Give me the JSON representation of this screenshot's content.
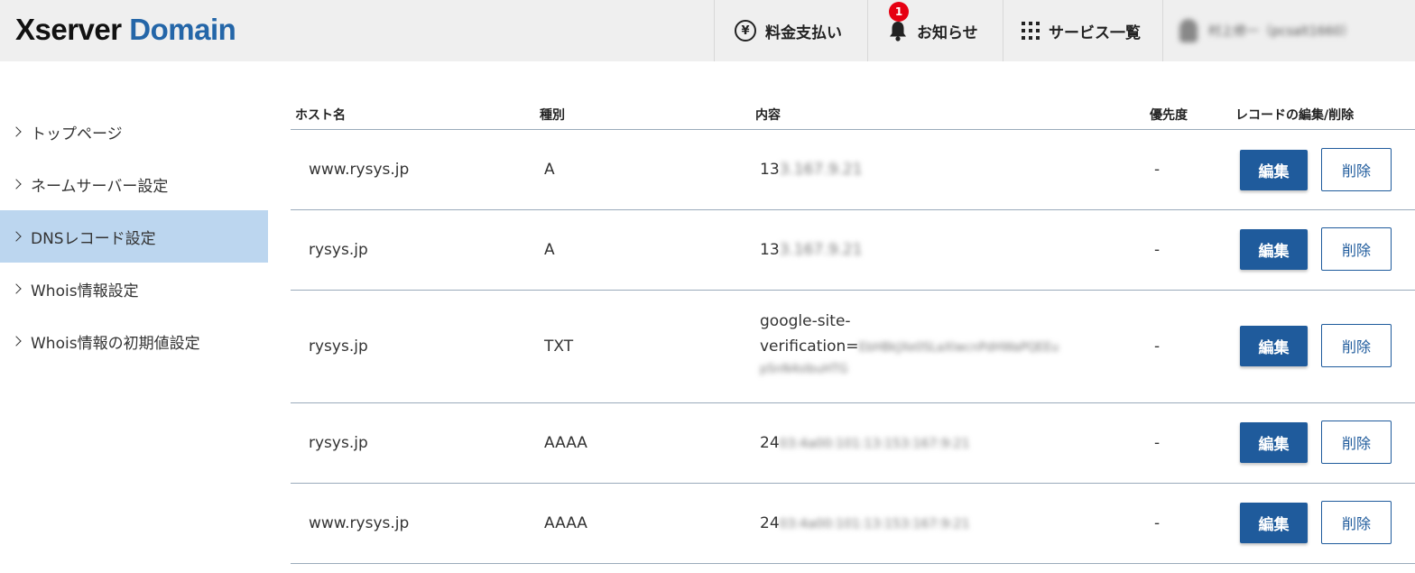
{
  "header": {
    "logo_part1": "Xserver",
    "logo_part2": "Domain",
    "nav": {
      "fee_label": "料金支払い",
      "fee_icon": "yen-circle-icon",
      "news_label": "お知らせ",
      "news_icon": "bell-icon",
      "news_badge": "1",
      "services_label": "サービス一覧",
      "services_icon": "grid-icon",
      "user_label": "村上修一（pcsalt1660）"
    }
  },
  "sidebar": {
    "items": [
      {
        "label": "トップページ"
      },
      {
        "label": "ネームサーバー設定"
      },
      {
        "label": "DNSレコード設定",
        "active": true
      },
      {
        "label": "Whois情報設定"
      },
      {
        "label": "Whois情報の初期値設定"
      }
    ]
  },
  "table": {
    "headers": {
      "host": "ホスト名",
      "type": "種別",
      "content": "内容",
      "priority": "優先度",
      "actions": "レコードの編集/削除"
    },
    "rows": [
      {
        "host": "www.rysys.jp",
        "type": "A",
        "content_visible": "13",
        "content_blurred": "3.167.9.21",
        "priority": "-",
        "edit": "編集",
        "delete": "削除"
      },
      {
        "host": "rysys.jp",
        "type": "A",
        "content_visible": "13",
        "content_blurred": "3.167.9.21",
        "priority": "-",
        "edit": "編集",
        "delete": "削除"
      },
      {
        "host": "rysys.jp",
        "type": "TXT",
        "content_line1": "google-site-",
        "content_line2": "verification=",
        "content_blurred2": "EbHBkJXe0SLaXlwcnPdHWaPQEEu",
        "content_blurred3": "pSnN4sIbuHTG",
        "priority": "-",
        "edit": "編集",
        "delete": "削除"
      },
      {
        "host": "rysys.jp",
        "type": "AAAA",
        "content_visible": "24",
        "content_blurred": "03:4a00:101:13:153:167:9:21",
        "priority": "-",
        "edit": "編集",
        "delete": "削除"
      },
      {
        "host": "www.rysys.jp",
        "type": "AAAA",
        "content_visible": "24",
        "content_blurred": "03:4a00:101:13:153:167:9:21",
        "priority": "-",
        "edit": "編集",
        "delete": "削除"
      }
    ]
  },
  "colors": {
    "header_bg": "#efefef",
    "brand_dark": "#111111",
    "brand_blue": "#2466a8",
    "sidebar_active": "#bcd6ef",
    "button_primary": "#1f5b9c",
    "badge": "#e60012"
  }
}
